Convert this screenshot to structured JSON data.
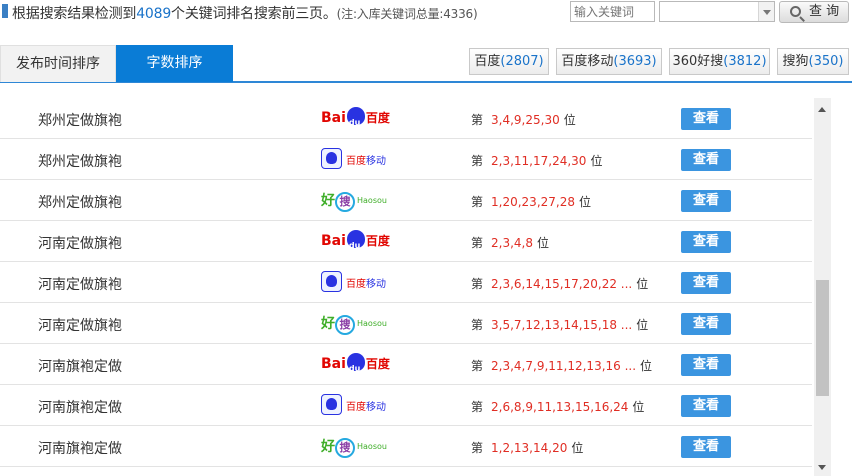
{
  "summary": {
    "prefix": "根据搜索结果检测到",
    "count": "4089",
    "suffix": "个关键词排名搜索前三页。",
    "note": "(注:入库关键词总量:4336)"
  },
  "search": {
    "placeholder": "输入关键词",
    "select_value": "",
    "button_label": "查 询"
  },
  "tabs": [
    {
      "label": "发布时间排序",
      "active": false
    },
    {
      "label": "字数排序",
      "active": true
    }
  ],
  "engine_filters": [
    {
      "name": "百度",
      "count": "(2807)"
    },
    {
      "name": "百度移动",
      "count": "(3693)"
    },
    {
      "name": "360好搜",
      "count": "(3812)"
    },
    {
      "name": "搜狗",
      "count": "(350)"
    }
  ],
  "rank_prefix": "第",
  "rank_suffix": "位",
  "view_label": "查看",
  "logos": {
    "baidu": {
      "bai": "Bai",
      "du": "百度"
    },
    "baidu_mobile": {
      "baidu": "百度",
      "mobile": "移动"
    },
    "haosou": {
      "hao": "好",
      "sou": "搜",
      "latin": "Haosou"
    }
  },
  "rows": [
    {
      "keyword": "郑州定做旗袍",
      "engine": "baidu",
      "positions": "3,4,9,25,30"
    },
    {
      "keyword": "郑州定做旗袍",
      "engine": "baidu_mobile",
      "positions": "2,3,11,17,24,30"
    },
    {
      "keyword": "郑州定做旗袍",
      "engine": "haosou",
      "positions": "1,20,23,27,28"
    },
    {
      "keyword": "河南定做旗袍",
      "engine": "baidu",
      "positions": "2,3,4,8"
    },
    {
      "keyword": "河南定做旗袍",
      "engine": "baidu_mobile",
      "positions": "2,3,6,14,15,17,20,22 ..."
    },
    {
      "keyword": "河南定做旗袍",
      "engine": "haosou",
      "positions": "3,5,7,12,13,14,15,18 ..."
    },
    {
      "keyword": "河南旗袍定做",
      "engine": "baidu",
      "positions": "2,3,4,7,9,11,12,13,16 ..."
    },
    {
      "keyword": "河南旗袍定做",
      "engine": "baidu_mobile",
      "positions": "2,6,8,9,11,13,15,16,24"
    },
    {
      "keyword": "河南旗袍定做",
      "engine": "haosou",
      "positions": "1,2,13,14,20"
    }
  ],
  "scroll_position": 0.72
}
